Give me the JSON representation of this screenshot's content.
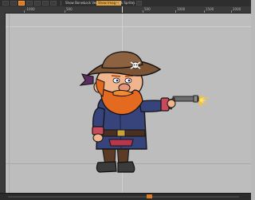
{
  "toolbar": {
    "items": [
      {
        "label": "Show Bones"
      },
      {
        "label": "Lock Vertex"
      },
      {
        "label": "Show Images"
      },
      {
        "label": "Lock Sprites"
      }
    ]
  },
  "ruler": {
    "top_labels": [
      "-1000",
      "500",
      "500",
      "1000",
      "1500",
      "2000"
    ]
  },
  "colors": {
    "accent": "#e07a1f",
    "canvas": "#bdbdbd",
    "toolbar": "#2e2e2e"
  },
  "character": {
    "description_icon": "pirate-character-icon"
  }
}
